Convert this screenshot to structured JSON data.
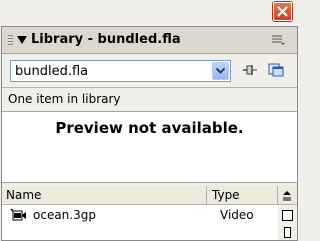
{
  "window": {
    "close_icon": "close-icon"
  },
  "panel": {
    "title": "Library - bundled.fla",
    "document_select": {
      "value": "bundled.fla"
    },
    "item_count_text": "One item in library",
    "preview_text": "Preview not available.",
    "columns": {
      "name": "Name",
      "type": "Type"
    },
    "items": [
      {
        "name": "ocean.3gp",
        "type": "Video",
        "icon": "video-icon"
      }
    ]
  },
  "colors": {
    "accent": "#7f9db9",
    "close": "#d6502c",
    "header_bg": "#dcd8cd"
  }
}
